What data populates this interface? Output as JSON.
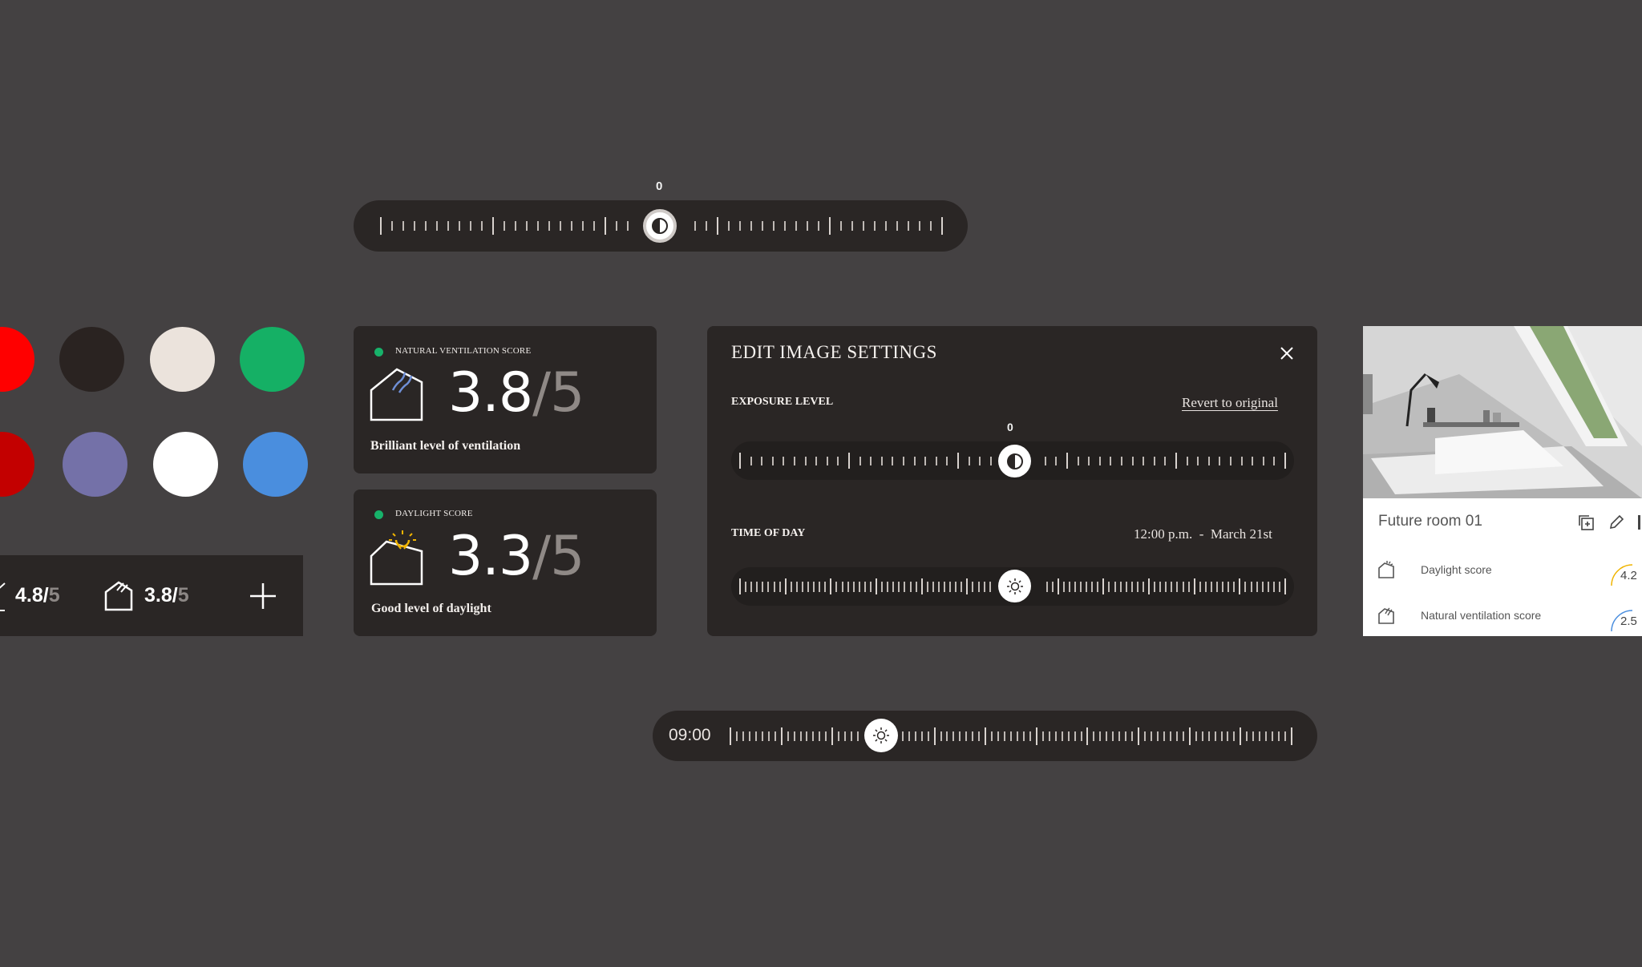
{
  "top_slider": {
    "value_label": "0",
    "icon": "contrast-icon"
  },
  "swatches": {
    "row1": [
      "#ff0000",
      "#2a2321",
      "#ebe3dc",
      "#15b065"
    ],
    "row2": [
      "#c30000",
      "#7471a8",
      "#ffffff",
      "#4a8ede"
    ]
  },
  "score_strip": {
    "daylight": {
      "value": "4.8/",
      "denominator": "5",
      "icon": "daylight-house-icon"
    },
    "ventilation": {
      "value": "3.8/",
      "denominator": "5",
      "icon": "ventilation-house-icon"
    },
    "add_icon": "plus-icon"
  },
  "ventilation_card": {
    "status_color": "#17b26a",
    "caption": "NATURAL VENTILATION SCORE",
    "score": "3.8",
    "denominator": "/5",
    "description": "Brilliant level of ventilation",
    "icon": "ventilation-house-icon"
  },
  "daylight_card": {
    "status_color": "#17b26a",
    "caption": "DAYLIGHT SCORE",
    "score": "3.3",
    "denominator": "/5",
    "description": "Good level of daylight",
    "icon": "daylight-house-icon"
  },
  "edit_panel": {
    "title": "EDIT IMAGE SETTINGS",
    "close_icon": "close-icon",
    "exposure": {
      "label": "EXPOSURE LEVEL",
      "revert": "Revert to original",
      "value_label": "0",
      "icon": "contrast-icon"
    },
    "time_of_day": {
      "label": "TIME OF DAY",
      "time": "12:00 p.m.",
      "separator": "-",
      "date": "March 21st",
      "icon": "sun-icon"
    }
  },
  "room_card": {
    "title": "Future room 01",
    "actions": [
      "duplicate-icon",
      "edit-pencil-icon"
    ],
    "rows": [
      {
        "label": "Daylight score",
        "value": "4.2",
        "icon": "daylight-house-icon",
        "gauge_color": "#f0b400"
      },
      {
        "label": "Natural ventilation score",
        "value": "2.5",
        "icon": "ventilation-house-icon",
        "gauge_color": "#4a8ede"
      }
    ]
  },
  "bottom_slider": {
    "time": "09:00",
    "icon": "sun-icon"
  },
  "colors": {
    "background": "#444142",
    "surface": "#2a2625",
    "accent_green": "#17b26a",
    "sun_yellow": "#f0b400",
    "air_blue": "#6f8fd6"
  }
}
